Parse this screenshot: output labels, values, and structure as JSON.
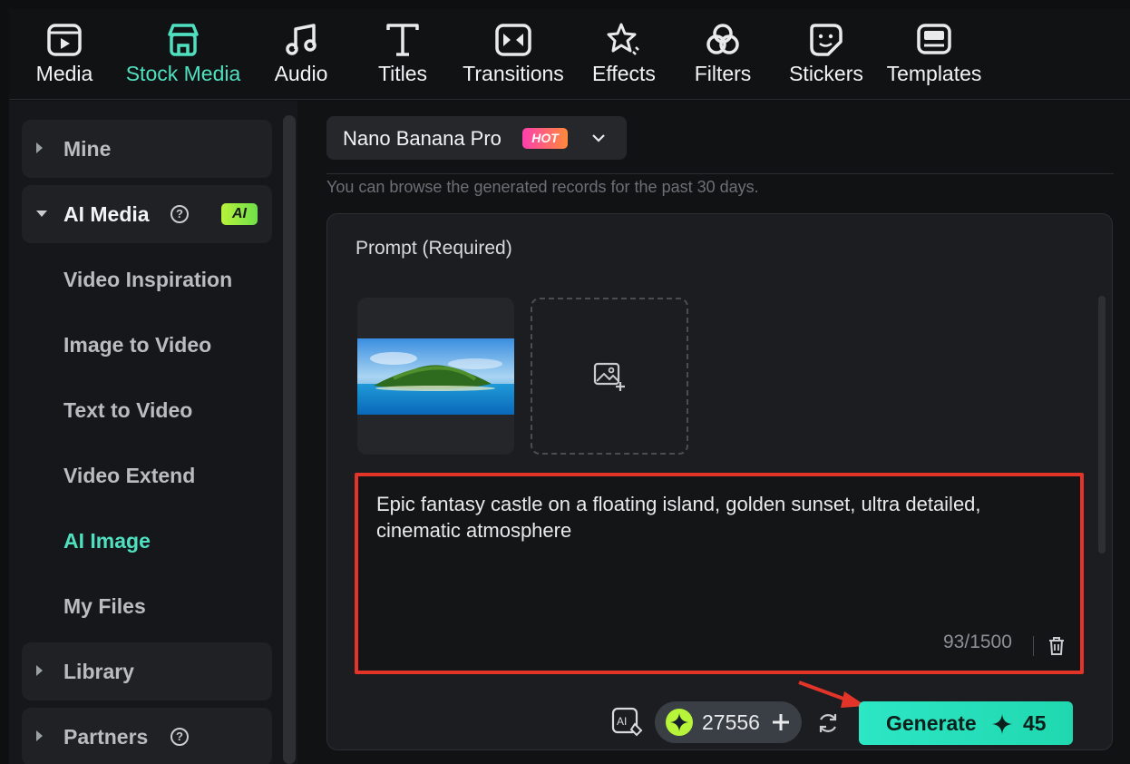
{
  "toolbar": {
    "items": [
      {
        "label": "Media",
        "icon": "media-icon",
        "active": false
      },
      {
        "label": "Stock Media",
        "icon": "stock-media-icon",
        "active": true
      },
      {
        "label": "Audio",
        "icon": "music-note-icon",
        "active": false
      },
      {
        "label": "Titles",
        "icon": "text-t-icon",
        "active": false
      },
      {
        "label": "Transitions",
        "icon": "transition-icon",
        "active": false
      },
      {
        "label": "Effects",
        "icon": "effects-star-icon",
        "active": false
      },
      {
        "label": "Filters",
        "icon": "filters-icon",
        "active": false
      },
      {
        "label": "Stickers",
        "icon": "sticker-icon",
        "active": false
      },
      {
        "label": "Templates",
        "icon": "template-icon",
        "active": false
      }
    ],
    "accent": "#4fe0c0"
  },
  "sidebar": {
    "mine": "Mine",
    "ai_media": "AI Media",
    "ai_badge": "AI",
    "help_glyph": "?",
    "items": [
      "Video Inspiration",
      "Image to Video",
      "Text to Video",
      "Video Extend",
      "AI Image",
      "My Files"
    ],
    "active_item": "AI Image",
    "library": "Library",
    "partners": "Partners"
  },
  "main": {
    "model": "Nano Banana Pro",
    "hot_badge": "HOT",
    "hint": "You can browse the generated records for the past 30 days.",
    "prompt_label": "Prompt (Required)",
    "prompt_text": "Epic fantasy castle on a floating island, golden sunset, ultra detailed, cinematic atmosphere",
    "char_count": "93/1500",
    "credits": "27556",
    "generate_label": "Generate",
    "generate_cost": "45"
  },
  "colors": {
    "highlight_border": "#e3342a",
    "generate_bg": "#2de6c4",
    "coin": "#b6f53a"
  }
}
